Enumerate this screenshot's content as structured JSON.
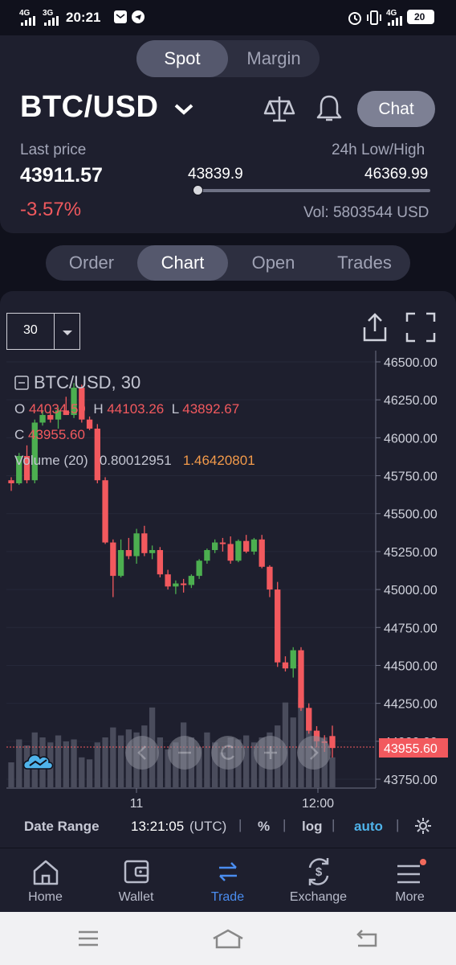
{
  "status_bar": {
    "net1": "4G",
    "net2": "3G",
    "time": "20:21",
    "net3": "4G",
    "battery": "20"
  },
  "market_switch": {
    "spot": "Spot",
    "margin": "Margin",
    "active": "Spot"
  },
  "header": {
    "pair": "BTC/USD",
    "chat_label": "Chat",
    "last_price_label": "Last price",
    "last_price": "43911.57",
    "change": "-3.57%",
    "low_high_label": "24h Low/High",
    "low": "43839.9",
    "high": "46369.99",
    "volume": "Vol: 5803544 USD"
  },
  "tabs": [
    "Order",
    "Chart",
    "Open",
    "Trades"
  ],
  "active_tab": "Chart",
  "chart": {
    "interval": "30",
    "legend_title": "BTC/USD, 30",
    "o_label": "O",
    "o_value": "44034.59",
    "h_label": "H",
    "h_value": "44103.26",
    "l_label": "L",
    "l_value": "43892.67",
    "c_label": "C",
    "c_value": "43955.60",
    "volume_label": "Volume (20)",
    "volume_value1": "0.80012951",
    "volume_value2": "1.46420801",
    "current_price_tag": "43955.60",
    "x_ticks": [
      "11",
      "12:00"
    ]
  },
  "chart_data": {
    "type": "candlestick",
    "title": "BTC/USD, 30",
    "y_ticks": [
      46500,
      46250,
      46000,
      45750,
      45500,
      45250,
      45000,
      44750,
      44500,
      44250,
      44000,
      43750
    ],
    "ylim": [
      43650,
      46520
    ],
    "up_color": "#4caf50",
    "down_color": "#f2595e",
    "candles": [
      {
        "o": 45720,
        "h": 45740,
        "l": 45650,
        "c": 45700
      },
      {
        "o": 45700,
        "h": 45900,
        "l": 45690,
        "c": 45880
      },
      {
        "o": 45880,
        "h": 45950,
        "l": 45700,
        "c": 45720
      },
      {
        "o": 45720,
        "h": 46120,
        "l": 45700,
        "c": 46100
      },
      {
        "o": 46100,
        "h": 46180,
        "l": 46080,
        "c": 46150
      },
      {
        "o": 46150,
        "h": 46200,
        "l": 46100,
        "c": 46120
      },
      {
        "o": 46120,
        "h": 46200,
        "l": 46060,
        "c": 46180
      },
      {
        "o": 46180,
        "h": 46270,
        "l": 46150,
        "c": 46150
      },
      {
        "o": 46150,
        "h": 46360,
        "l": 46130,
        "c": 46330
      },
      {
        "o": 46330,
        "h": 46350,
        "l": 46100,
        "c": 46120
      },
      {
        "o": 46120,
        "h": 46140,
        "l": 46050,
        "c": 46060
      },
      {
        "o": 46060,
        "h": 46090,
        "l": 45700,
        "c": 45720
      },
      {
        "o": 45720,
        "h": 45740,
        "l": 45300,
        "c": 45310
      },
      {
        "o": 45310,
        "h": 45330,
        "l": 44950,
        "c": 45090
      },
      {
        "o": 45090,
        "h": 45330,
        "l": 45080,
        "c": 45260
      },
      {
        "o": 45260,
        "h": 45340,
        "l": 45200,
        "c": 45220
      },
      {
        "o": 45220,
        "h": 45400,
        "l": 45170,
        "c": 45370
      },
      {
        "o": 45370,
        "h": 45420,
        "l": 45220,
        "c": 45240
      },
      {
        "o": 45240,
        "h": 45290,
        "l": 45200,
        "c": 45260
      },
      {
        "o": 45260,
        "h": 45280,
        "l": 45080,
        "c": 45100
      },
      {
        "o": 45100,
        "h": 45130,
        "l": 45000,
        "c": 45020
      },
      {
        "o": 45020,
        "h": 45060,
        "l": 44970,
        "c": 45040
      },
      {
        "o": 45040,
        "h": 45070,
        "l": 44980,
        "c": 45030
      },
      {
        "o": 45030,
        "h": 45100,
        "l": 45010,
        "c": 45090
      },
      {
        "o": 45090,
        "h": 45200,
        "l": 45070,
        "c": 45190
      },
      {
        "o": 45190,
        "h": 45270,
        "l": 45170,
        "c": 45260
      },
      {
        "o": 45260,
        "h": 45330,
        "l": 45240,
        "c": 45310
      },
      {
        "o": 45310,
        "h": 45340,
        "l": 45250,
        "c": 45300
      },
      {
        "o": 45300,
        "h": 45350,
        "l": 45170,
        "c": 45190
      },
      {
        "o": 45190,
        "h": 45330,
        "l": 45180,
        "c": 45320
      },
      {
        "o": 45320,
        "h": 45360,
        "l": 45240,
        "c": 45250
      },
      {
        "o": 45250,
        "h": 45340,
        "l": 45230,
        "c": 45330
      },
      {
        "o": 45330,
        "h": 45360,
        "l": 45140,
        "c": 45150
      },
      {
        "o": 45150,
        "h": 45160,
        "l": 44950,
        "c": 45000
      },
      {
        "o": 45000,
        "h": 45050,
        "l": 44490,
        "c": 44520
      },
      {
        "o": 44520,
        "h": 44560,
        "l": 44460,
        "c": 44480
      },
      {
        "o": 44480,
        "h": 44620,
        "l": 44420,
        "c": 44600
      },
      {
        "o": 44600,
        "h": 44620,
        "l": 44200,
        "c": 44220
      },
      {
        "o": 44220,
        "h": 44250,
        "l": 44050,
        "c": 44070
      },
      {
        "o": 44070,
        "h": 44100,
        "l": 43960,
        "c": 44000
      },
      {
        "o": 44000,
        "h": 44040,
        "l": 43930,
        "c": 43990
      },
      {
        "o": 44034.59,
        "h": 44103.26,
        "l": 43892.67,
        "c": 43955.6
      }
    ],
    "volumes": [
      0.25,
      0.48,
      0.42,
      0.55,
      0.5,
      0.45,
      0.52,
      0.46,
      0.48,
      0.3,
      0.28,
      0.45,
      0.5,
      0.6,
      0.52,
      0.58,
      0.55,
      0.62,
      0.8,
      0.5,
      0.38,
      0.45,
      0.65,
      0.5,
      0.4,
      0.55,
      0.45,
      0.35,
      0.5,
      0.48,
      0.52,
      0.45,
      0.5,
      0.55,
      0.62,
      0.85,
      0.7,
      0.9,
      0.6,
      0.55,
      0.5,
      0.3
    ]
  },
  "chart_toolbar": {
    "date_range": "Date Range",
    "time": "13:21:05",
    "tz": "(UTC)",
    "percent": "%",
    "log": "log",
    "auto": "auto"
  },
  "bottom_nav": [
    {
      "label": "Home",
      "icon": "home-icon"
    },
    {
      "label": "Wallet",
      "icon": "wallet-icon"
    },
    {
      "label": "Trade",
      "icon": "trade-arrows-icon"
    },
    {
      "label": "Exchange",
      "icon": "exchange-icon"
    },
    {
      "label": "More",
      "icon": "menu-icon"
    }
  ],
  "active_nav": "Trade",
  "colors": {
    "accent_blue": "#4a8df0",
    "negative": "#f0595e",
    "positive": "#4caf50",
    "auto_blue": "#4fb3ea"
  }
}
